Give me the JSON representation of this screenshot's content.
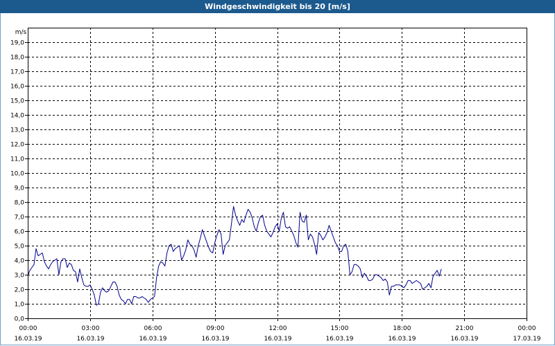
{
  "window": {
    "title": "Windgeschwindigkeit bis 20 [m/s]"
  },
  "chart_data": {
    "type": "line",
    "title": "Windgeschwindigkeit bis 20 [m/s]",
    "ylabel": "m/s",
    "xlabel": "",
    "ylim": [
      0,
      20
    ],
    "grid": true,
    "y_ticks": [
      "0,0",
      "1,0",
      "2,0",
      "3,0",
      "4,0",
      "5,0",
      "6,0",
      "7,0",
      "8,0",
      "9,0",
      "10,0",
      "11,0",
      "12,0",
      "13,0",
      "14,0",
      "15,0",
      "16,0",
      "17,0",
      "18,0",
      "19,0"
    ],
    "x_ticks": [
      {
        "time": "00:00",
        "date": "16.03.19"
      },
      {
        "time": "03:00",
        "date": "16.03.19"
      },
      {
        "time": "06:00",
        "date": "16.03.19"
      },
      {
        "time": "09:00",
        "date": "16.03.19"
      },
      {
        "time": "12:00",
        "date": "16.03.19"
      },
      {
        "time": "15:00",
        "date": "16.03.19"
      },
      {
        "time": "18:00",
        "date": "16.03.19"
      },
      {
        "time": "21:00",
        "date": "16.03.19"
      },
      {
        "time": "00:00",
        "date": "17.03.19"
      }
    ],
    "xlim_hours": [
      0,
      24
    ],
    "line_color": "#00008b",
    "series": [
      {
        "x_hours": [
          0.0,
          0.1,
          0.2,
          0.3,
          0.4,
          0.5,
          0.6,
          0.7,
          0.8,
          0.9,
          1.0,
          1.1,
          1.2,
          1.3,
          1.4,
          1.5,
          1.6,
          1.7,
          1.8,
          1.9,
          2.0,
          2.1,
          2.2,
          2.3,
          2.4,
          2.5,
          2.6,
          2.7,
          2.8,
          2.9,
          3.0,
          3.1,
          3.2,
          3.3,
          3.4,
          3.5,
          3.6,
          3.7,
          3.8,
          3.9,
          4.0,
          4.1,
          4.2,
          4.3,
          4.4,
          4.5,
          4.6,
          4.7,
          4.8,
          4.9,
          5.0,
          5.1,
          5.2,
          5.3,
          5.4,
          5.5,
          5.6,
          5.7,
          5.8,
          5.9,
          6.0,
          6.1,
          6.2,
          6.3,
          6.4,
          6.5,
          6.6,
          6.7,
          6.8,
          6.9,
          7.0,
          7.1,
          7.2,
          7.3,
          7.4,
          7.5,
          7.6,
          7.7,
          7.8,
          7.9,
          8.0,
          8.1,
          8.2,
          8.3,
          8.4,
          8.5,
          8.6,
          8.7,
          8.8,
          8.9,
          9.0,
          9.1,
          9.2,
          9.3,
          9.4,
          9.5,
          9.6,
          9.7,
          9.8,
          9.9,
          10.0,
          10.1,
          10.2,
          10.3,
          10.4,
          10.5,
          10.6,
          10.7,
          10.8,
          10.9,
          11.0,
          11.1,
          11.2,
          11.3,
          11.4,
          11.5,
          11.6,
          11.7,
          11.8,
          11.9,
          12.0,
          12.1,
          12.2,
          12.3,
          12.4,
          12.5,
          12.6,
          12.7,
          12.8,
          12.9,
          13.0,
          13.1,
          13.2,
          13.3,
          13.4,
          13.5,
          13.6,
          13.7,
          13.8,
          13.9,
          14.0,
          14.1,
          14.2,
          14.3,
          14.4,
          14.5,
          14.6,
          14.7,
          14.8,
          14.9,
          15.0,
          15.1,
          15.2,
          15.3,
          15.4,
          15.5,
          15.6,
          15.7,
          15.8,
          15.9,
          16.0,
          16.1,
          16.2,
          16.3,
          16.4,
          16.5,
          16.6,
          16.7,
          16.8,
          16.9,
          17.0,
          17.1,
          17.2,
          17.3,
          17.4,
          17.5,
          17.6,
          17.7,
          17.8,
          17.9,
          18.0,
          18.1,
          18.2,
          18.3,
          18.4,
          18.5,
          18.6,
          18.7,
          18.8,
          18.9,
          19.0,
          19.1,
          19.2,
          19.3,
          19.4,
          19.5,
          19.6,
          19.7,
          19.8,
          19.9,
          20.0,
          20.1,
          20.2,
          20.3,
          20.4,
          20.5,
          20.6,
          20.7,
          20.8,
          20.9,
          21.0,
          21.1,
          21.2,
          21.3,
          21.4,
          21.5,
          21.6,
          21.7,
          21.8,
          21.9,
          22.0,
          22.1,
          22.2,
          22.3,
          22.4,
          22.5,
          22.6,
          22.7,
          22.8,
          22.9,
          23.0,
          23.1,
          23.2,
          23.3,
          23.4,
          23.5,
          23.6,
          23.7,
          23.8
        ],
        "values": [
          2.9,
          3.3,
          3.5,
          3.7,
          4.8,
          4.3,
          4.4,
          4.5,
          3.9,
          3.6,
          3.4,
          3.7,
          3.9,
          4.0,
          4.1,
          3.0,
          3.9,
          4.1,
          4.1,
          3.5,
          3.8,
          3.7,
          3.3,
          3.2,
          2.5,
          3.4,
          2.8,
          2.3,
          2.2,
          2.2,
          2.3,
          2.0,
          1.6,
          0.9,
          1.0,
          1.8,
          2.1,
          1.9,
          1.8,
          1.9,
          2.2,
          2.5,
          2.5,
          2.2,
          1.6,
          1.3,
          1.2,
          1.0,
          1.3,
          1.3,
          1.0,
          1.5,
          1.5,
          1.4,
          1.4,
          1.5,
          1.4,
          1.3,
          1.1,
          1.3,
          1.4,
          1.5,
          2.8,
          3.6,
          3.9,
          3.8,
          3.6,
          4.5,
          5.0,
          5.1,
          4.6,
          4.8,
          4.9,
          5.0,
          4.0,
          4.3,
          4.7,
          5.4,
          5.1,
          5.0,
          4.7,
          4.2,
          5.0,
          5.5,
          6.1,
          5.7,
          5.3,
          4.9,
          4.6,
          4.5,
          5.2,
          5.7,
          6.1,
          5.8,
          4.4,
          5.0,
          5.2,
          5.4,
          6.5,
          7.7,
          7.1,
          6.7,
          6.4,
          6.8,
          6.6,
          7.1,
          7.5,
          7.3,
          6.9,
          6.3,
          6.0,
          6.6,
          7.0,
          7.1,
          6.4,
          6.0,
          5.8,
          5.6,
          5.9,
          6.3,
          6.5,
          6.0,
          6.9,
          7.3,
          6.3,
          6.2,
          6.3,
          6.0,
          5.7,
          5.2,
          4.9,
          7.3,
          6.7,
          6.6,
          7.1,
          5.4,
          5.8,
          5.6,
          5.1,
          4.4,
          5.9,
          5.7,
          5.4,
          5.6,
          5.9,
          6.4,
          6.0,
          5.6,
          5.2,
          5.0,
          4.6,
          4.6,
          5.0,
          5.1,
          4.6,
          3.0,
          3.2,
          3.7,
          3.7,
          3.6,
          3.4,
          2.8,
          3.1,
          2.9,
          2.6,
          2.6,
          2.7,
          3.0,
          3.0,
          2.9,
          2.8,
          2.6,
          2.7,
          2.5,
          1.6,
          2.2,
          2.2,
          2.3,
          2.3,
          2.3,
          2.2,
          2.1,
          2.3,
          2.6,
          2.6,
          2.4,
          2.5,
          2.6,
          2.5,
          2.4,
          2.0,
          2.1,
          2.2,
          2.4,
          2.1,
          2.9,
          3.1,
          3.3,
          2.9,
          3.4
        ]
      }
    ]
  }
}
